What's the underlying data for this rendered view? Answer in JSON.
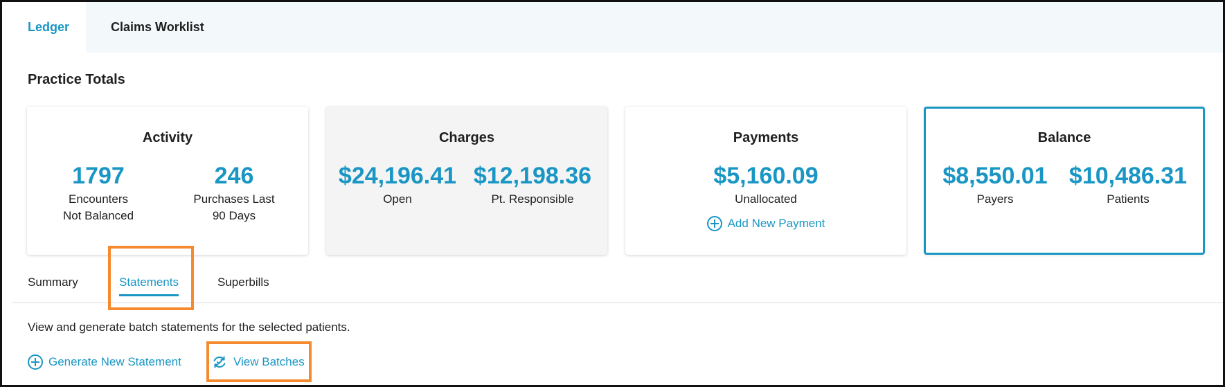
{
  "tabs": {
    "ledger": "Ledger",
    "claims_worklist": "Claims Worklist"
  },
  "section_title": "Practice Totals",
  "cards": {
    "activity": {
      "title": "Activity",
      "metric1_value": "1797",
      "metric1_label_line1": "Encounters",
      "metric1_label_line2": "Not Balanced",
      "metric2_value": "246",
      "metric2_label_line1": "Purchases Last",
      "metric2_label_line2": "90 Days"
    },
    "charges": {
      "title": "Charges",
      "metric1_value": "$24,196.41",
      "metric1_label": "Open",
      "metric2_value": "$12,198.36",
      "metric2_label": "Pt. Responsible"
    },
    "payments": {
      "title": "Payments",
      "metric_value": "$5,160.09",
      "metric_label": "Unallocated",
      "action_label": "Add New Payment"
    },
    "balance": {
      "title": "Balance",
      "metric1_value": "$8,550.01",
      "metric1_label": "Payers",
      "metric2_value": "$10,486.31",
      "metric2_label": "Patients"
    }
  },
  "subtabs": {
    "summary": "Summary",
    "statements": "Statements",
    "superbills": "Superbills"
  },
  "statements": {
    "description": "View and generate batch statements for the selected patients.",
    "generate_label": "Generate New Statement",
    "view_batches_label": "View Batches"
  },
  "icons": {
    "add_payment": "plus-circle-icon",
    "generate_statement": "plus-circle-icon",
    "view_batches": "refresh-icon"
  },
  "colors": {
    "accent": "#1996c4",
    "highlight": "#f58a2e",
    "tab_bar_background": "#f3f8fb",
    "shaded_card_background": "#f4f4f4"
  }
}
